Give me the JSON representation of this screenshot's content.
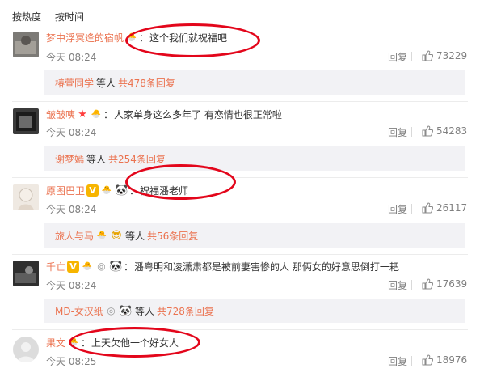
{
  "sort": {
    "hot": "按热度",
    "time": "按时间"
  },
  "actions": {
    "reply": "回复"
  },
  "comments": [
    {
      "user": "梦中浮冥逢的宿帆",
      "text": "这个我们就祝福吧",
      "time": "今天 08:24",
      "likes": "73229",
      "sub": {
        "name": "椿萱同学",
        "mid": "等人",
        "more": "共478条回复"
      }
    },
    {
      "user": "皱皱咦",
      "text": "人家单身这么多年了 有恋情也很正常啦",
      "time": "今天 08:24",
      "likes": "54283",
      "sub": {
        "name": "谢梦嫣",
        "mid": "等人",
        "more": "共254条回复"
      }
    },
    {
      "user": "原图巴卫",
      "text": "祝福潘老师",
      "time": "今天 08:24",
      "likes": "26117",
      "sub": {
        "name": "旅人与马",
        "mid": "等人",
        "more": "共56条回复"
      }
    },
    {
      "user": "千亡",
      "text": "潘粤明和凌潇肃都是被前妻害惨的人  那俩女的好意思倒打一耙",
      "time": "今天 08:24",
      "likes": "17639",
      "sub": {
        "name": "MD-女汉纸",
        "mid": "等人",
        "more": "共728条回复"
      }
    },
    {
      "user": "果文",
      "text": "上天欠他一个好女人",
      "time": "今天 08:25",
      "likes": "18976"
    }
  ],
  "colors": {
    "username": "#eb7350",
    "highlight": "#e3061b",
    "sub_bg": "#f2f2f5",
    "meta": "#808080"
  }
}
